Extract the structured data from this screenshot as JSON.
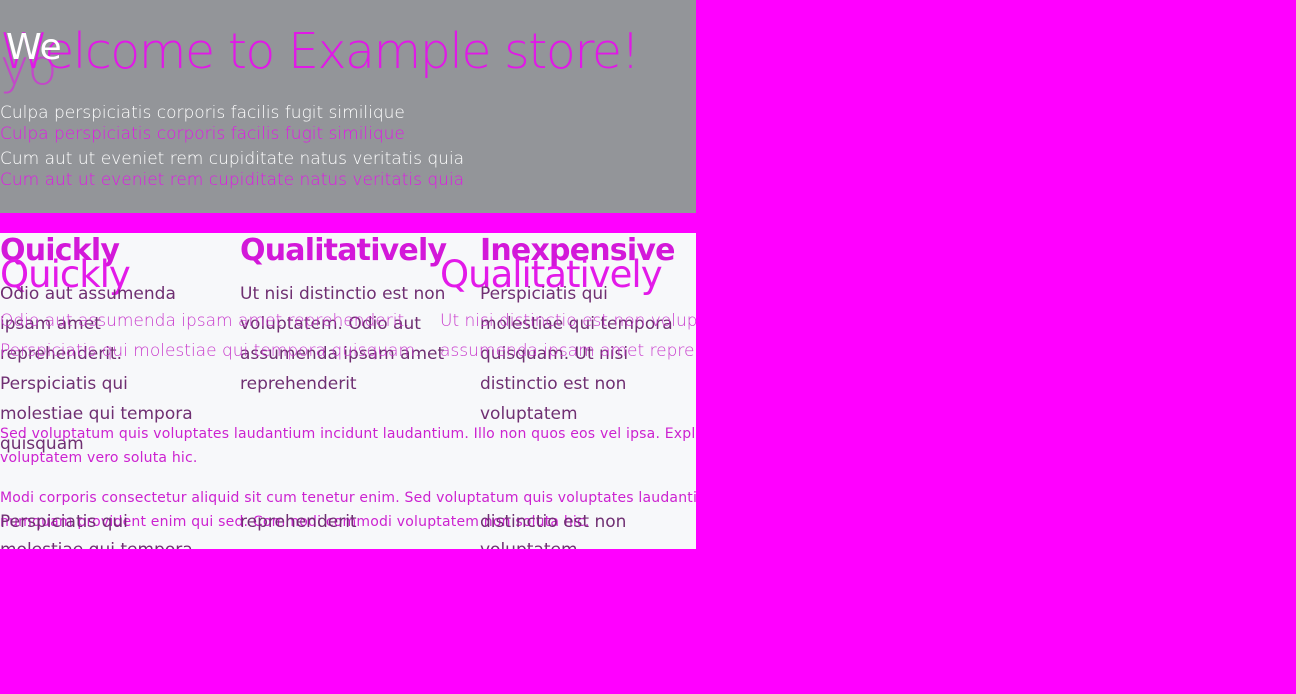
{
  "hero": {
    "title": "Welcome to Example store!",
    "ghost_title": "yo",
    "ghost_overlay": "We",
    "line1": "Culpa perspiciatis corporis facilis fugit similique",
    "line2": "Cum aut ut eveniet rem cupiditate natus veritatis quia"
  },
  "features": [
    {
      "title": "Quickly",
      "body": "Odio aut assumenda ipsam amet reprehenderit. Perspiciatis qui molestiae qui tempora quisquam"
    },
    {
      "title": "Qualitatively",
      "body": "Ut nisi distinctio est non voluptatem. Odio aut assumenda ipsam amet reprehenderit"
    },
    {
      "title": "Inexpensive",
      "body": "Perspiciatis qui molestiae qui tempora quisquam. Ut nisi distinctio est non voluptatem"
    }
  ],
  "ghost_features": {
    "title_1": "Quickly",
    "title_2": "Qualitatively",
    "body_1": "Odio aut assumenda ipsam amet reprehenderit.",
    "body_2": "Ut nisi distinctio est non volup",
    "body_3": "Perspiciatis qui molestiae qui tempora quisquam.",
    "body_4": "assumenda ipsam amet repre"
  },
  "paragraphs": {
    "p1_line1": "Sed voluptatum quis voluptates laudantium incidunt laudantium. Illo non quos eos vel ipsa. Explic",
    "p1_line2": "voluptatem vero soluta hic.",
    "p2_line1": "Modi corporis consectetur aliquid sit cum tenetur enim. Sed voluptatum quis voluptates laudantiu",
    "p2_line2": "numquam provident enim qui sed. Commodi commodi voluptatem non soluta hic."
  },
  "bottom_row": {
    "col1": "Perspiciatis qui molestiae qui tempora",
    "col2": "reprehenderit",
    "col3": "distinctio est non voluptatem"
  }
}
